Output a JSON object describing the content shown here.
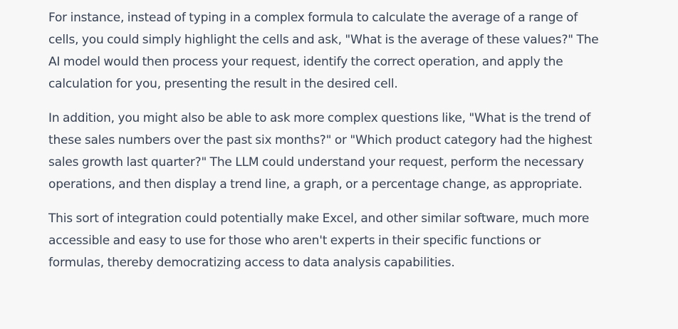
{
  "response": {
    "paragraphs": [
      "For instance, instead of typing in a complex formula to calculate the average of a range of\ncells, you could simply highlight the cells and ask, \"What is the average of these values?\" The\nAI model would then process your request, identify the correct operation, and apply the\ncalculation for you, presenting the result in the desired cell.",
      "In addition, you might also be able to ask more complex questions like, \"What is the trend of\nthese sales numbers over the past six months?\" or \"Which product category had the highest\nsales growth last quarter?\" The LLM could understand your request, perform the necessary\noperations, and then display a trend line, a graph, or a percentage change, as appropriate.",
      "This sort of integration could potentially make Excel, and other similar software, much more\naccessible and easy to use for those who aren't experts in their specific functions or\nformulas, thereby democratizing access to data analysis capabilities."
    ]
  }
}
